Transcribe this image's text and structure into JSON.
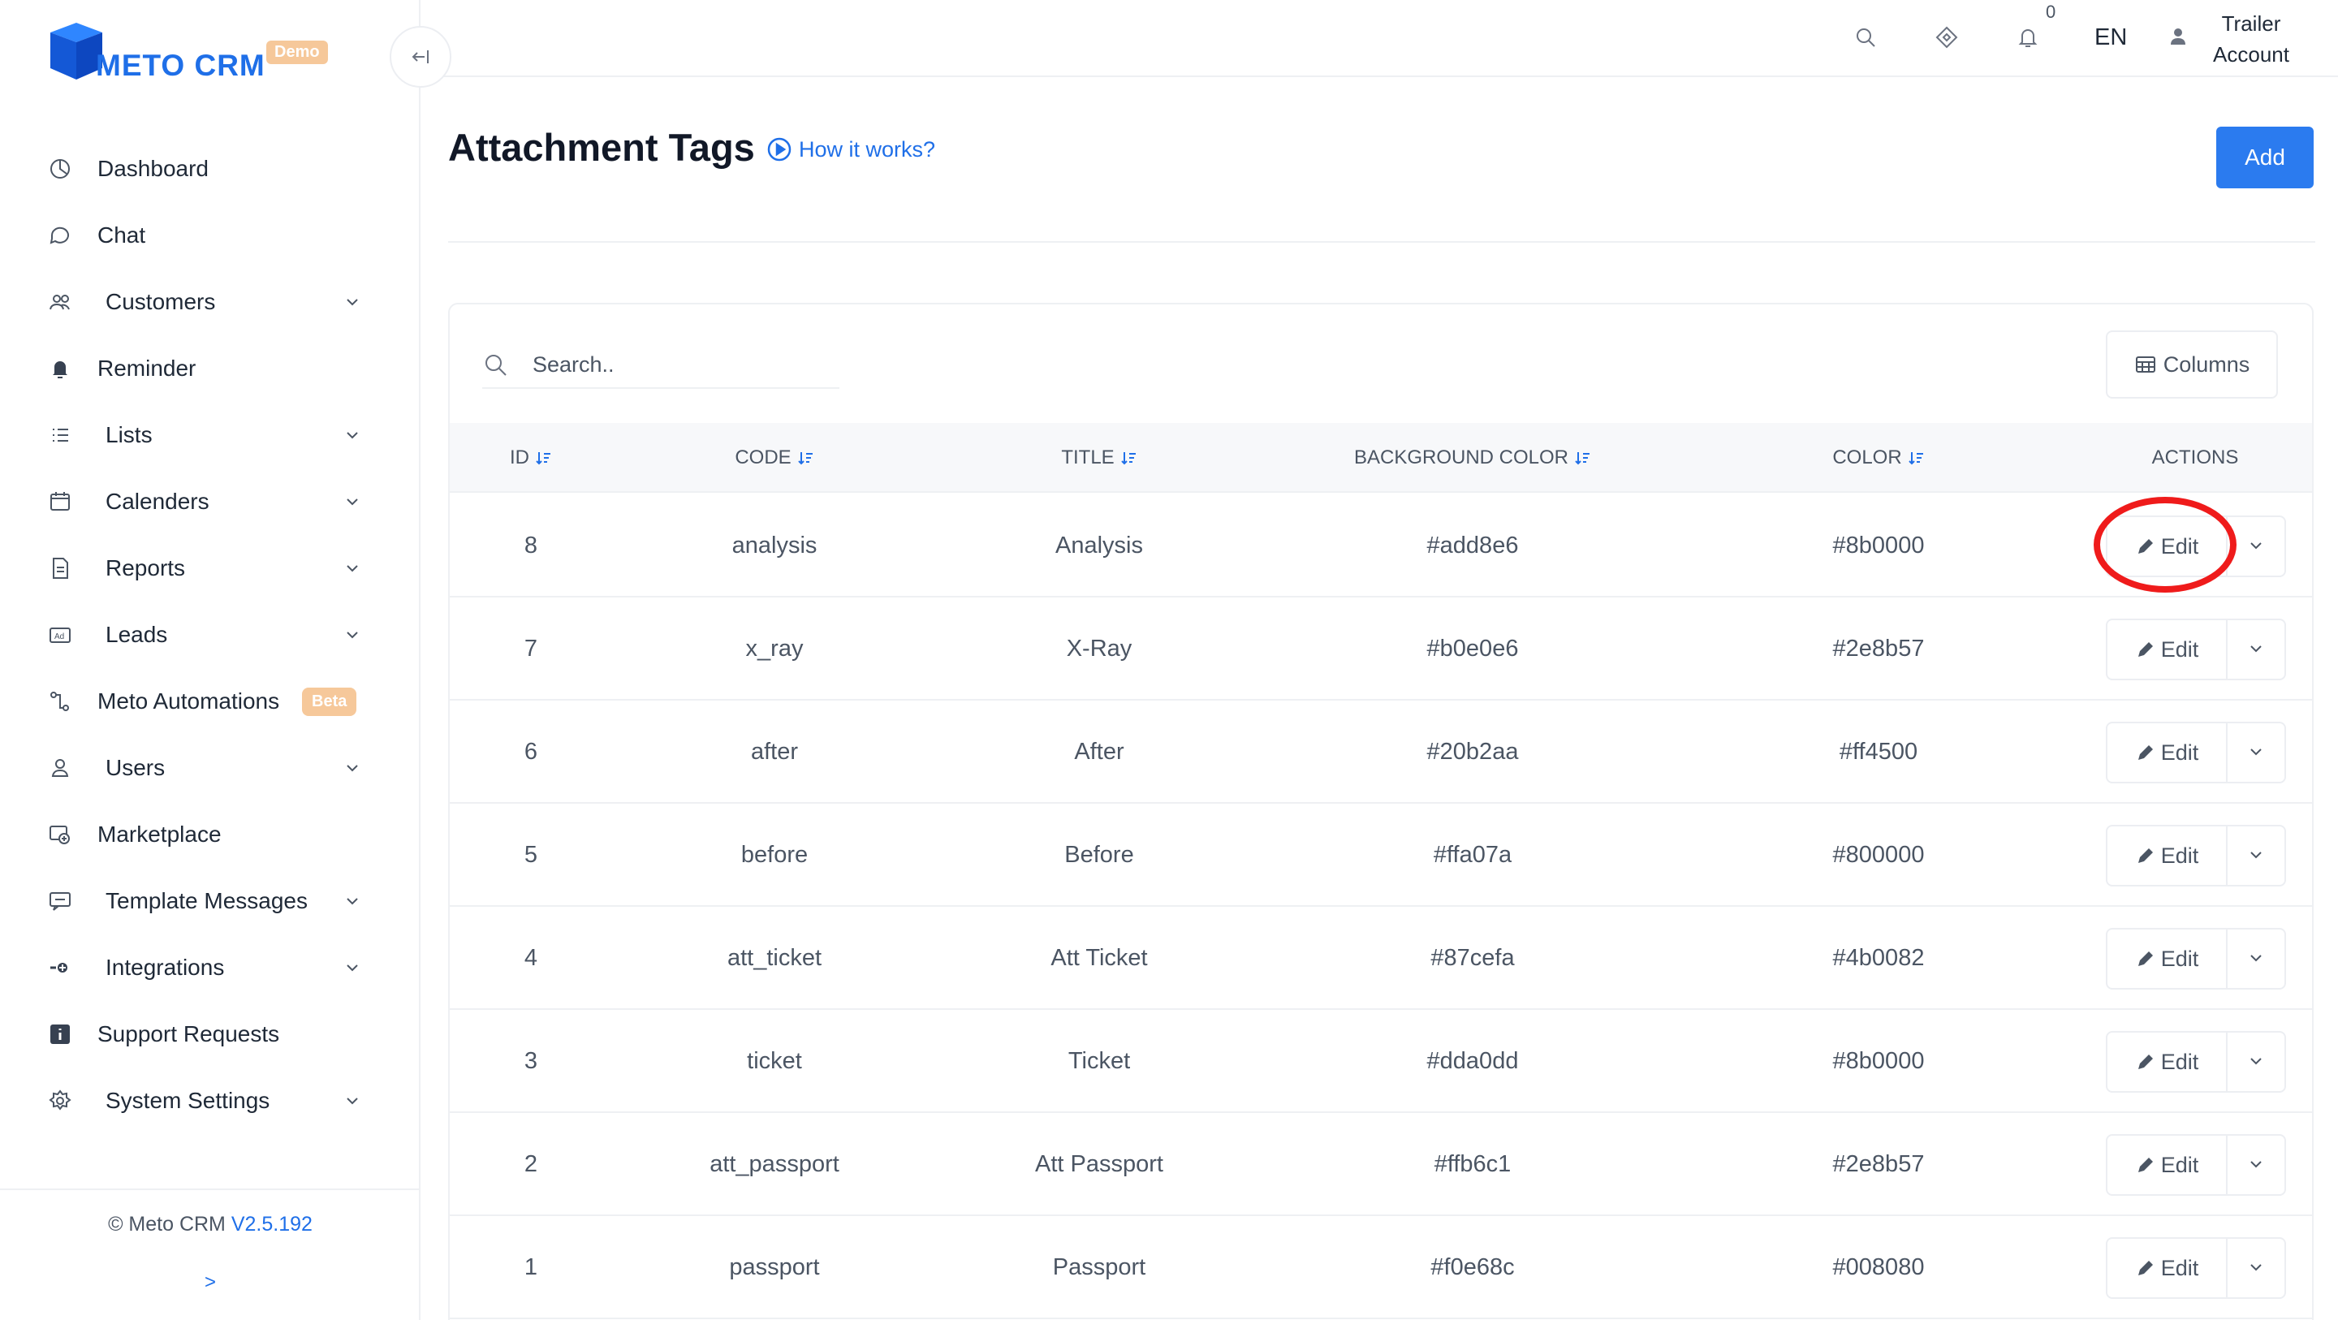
{
  "app": {
    "name": "METO CRM",
    "badge": "Demo",
    "brand_color": "#1f6fe8"
  },
  "sidebar": {
    "items": [
      {
        "label": "Dashboard",
        "icon": "dashboard-icon",
        "has_submenu": false
      },
      {
        "label": "Chat",
        "icon": "chat-icon",
        "has_submenu": false
      },
      {
        "label": "Customers",
        "icon": "customers-icon",
        "has_submenu": true
      },
      {
        "label": "Reminder",
        "icon": "bell-icon",
        "has_submenu": false
      },
      {
        "label": "Lists",
        "icon": "list-icon",
        "has_submenu": true
      },
      {
        "label": "Calenders",
        "icon": "calendar-icon",
        "has_submenu": true
      },
      {
        "label": "Reports",
        "icon": "report-icon",
        "has_submenu": true
      },
      {
        "label": "Leads",
        "icon": "ad-icon",
        "has_submenu": true
      },
      {
        "label": "Meto Automations",
        "icon": "automation-icon",
        "has_submenu": false,
        "badge": "Beta"
      },
      {
        "label": "Users",
        "icon": "user-icon",
        "has_submenu": true
      },
      {
        "label": "Marketplace",
        "icon": "marketplace-icon",
        "has_submenu": false
      },
      {
        "label": "Template Messages",
        "icon": "template-icon",
        "has_submenu": true
      },
      {
        "label": "Integrations",
        "icon": "integration-icon",
        "has_submenu": true
      },
      {
        "label": "Support Requests",
        "icon": "info-icon",
        "has_submenu": false
      },
      {
        "label": "System Settings",
        "icon": "gear-icon",
        "has_submenu": true
      }
    ],
    "footer": {
      "copyright": "© Meto CRM",
      "version": "V2.5.192",
      "expand": ">"
    }
  },
  "topbar": {
    "notification_count": "0",
    "language": "EN",
    "user_line1": "Trailer",
    "user_line2": "Account"
  },
  "page": {
    "title": "Attachment Tags",
    "help_link": "How it works?",
    "add_label": "Add"
  },
  "table": {
    "search_placeholder": "Search..",
    "columns_label": "Columns",
    "headers": {
      "id": "ID",
      "code": "CODE",
      "title": "TITLE",
      "background_color": "BACKGROUND COLOR",
      "color": "COLOR",
      "actions": "ACTIONS"
    },
    "edit_label": "Edit",
    "rows": [
      {
        "id": "8",
        "code": "analysis",
        "title": "Analysis",
        "background_color": "#add8e6",
        "color": "#8b0000"
      },
      {
        "id": "7",
        "code": "x_ray",
        "title": "X-Ray",
        "background_color": "#b0e0e6",
        "color": "#2e8b57"
      },
      {
        "id": "6",
        "code": "after",
        "title": "After",
        "background_color": "#20b2aa",
        "color": "#ff4500"
      },
      {
        "id": "5",
        "code": "before",
        "title": "Before",
        "background_color": "#ffa07a",
        "color": "#800000"
      },
      {
        "id": "4",
        "code": "att_ticket",
        "title": "Att Ticket",
        "background_color": "#87cefa",
        "color": "#4b0082"
      },
      {
        "id": "3",
        "code": "ticket",
        "title": "Ticket",
        "background_color": "#dda0dd",
        "color": "#8b0000"
      },
      {
        "id": "2",
        "code": "att_passport",
        "title": "Att Passport",
        "background_color": "#ffb6c1",
        "color": "#2e8b57"
      },
      {
        "id": "1",
        "code": "passport",
        "title": "Passport",
        "background_color": "#f0e68c",
        "color": "#008080"
      }
    ]
  }
}
